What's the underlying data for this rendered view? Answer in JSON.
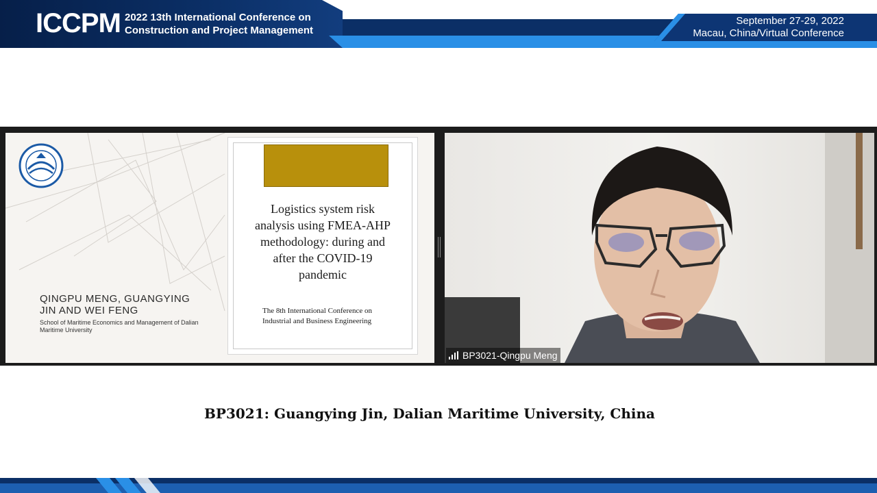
{
  "header": {
    "logo_text": "ICCPM",
    "conference_line1": "2022 13th International Conference on",
    "conference_line2": "Construction and Project Management",
    "date_line": "September 27-29, 2022",
    "location_line": "Macau, China/Virtual Conference"
  },
  "slide": {
    "authors_line1": "QINGPU MENG, GUANGYING",
    "authors_line2": "JIN AND WEI FENG",
    "affiliation_line1": "School of Maritime Economics and Management of Dalian",
    "affiliation_line2": "Maritime University",
    "title_lines": [
      "Logistics system risk",
      "analysis using FMEA-AHP",
      "methodology: during and",
      "after the COVID-19",
      "pandemic"
    ],
    "conference_note_line1": "The 8th International Conference on",
    "conference_note_line2": "Industrial and Business Engineering"
  },
  "participant": {
    "name_label": "BP3021-Qingpu Meng"
  },
  "caption": "BP3021: Guangying Jin, Dalian Maritime University, China",
  "colors": {
    "banner_dark": "#0b2a5c",
    "banner_light": "#2a8fe6",
    "gold": "#b8900c"
  }
}
